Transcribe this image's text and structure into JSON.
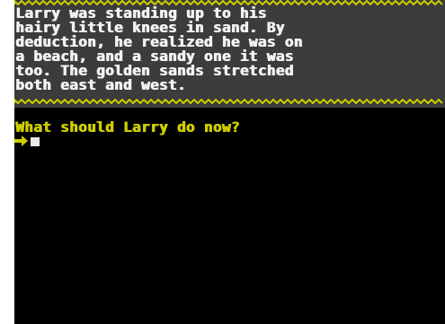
{
  "colors": {
    "background": "#000000",
    "description_panel": "#3c3c3c",
    "description_text": "#f2f2f2",
    "border_wave": "#cdcd00",
    "prompt_text": "#cdcd00",
    "cursor": "#e8e8e8"
  },
  "description": {
    "lines": [
      "Larry was standing up to his",
      "hairy little knees in sand. By",
      "deduction, he realized he was on",
      "a beach, and a sandy one it was",
      "too. The golden sands stretched",
      "both east and west."
    ]
  },
  "prompt": {
    "question": "What should Larry do now?",
    "input_value": "",
    "arrow_icon": "right-arrow-icon"
  }
}
